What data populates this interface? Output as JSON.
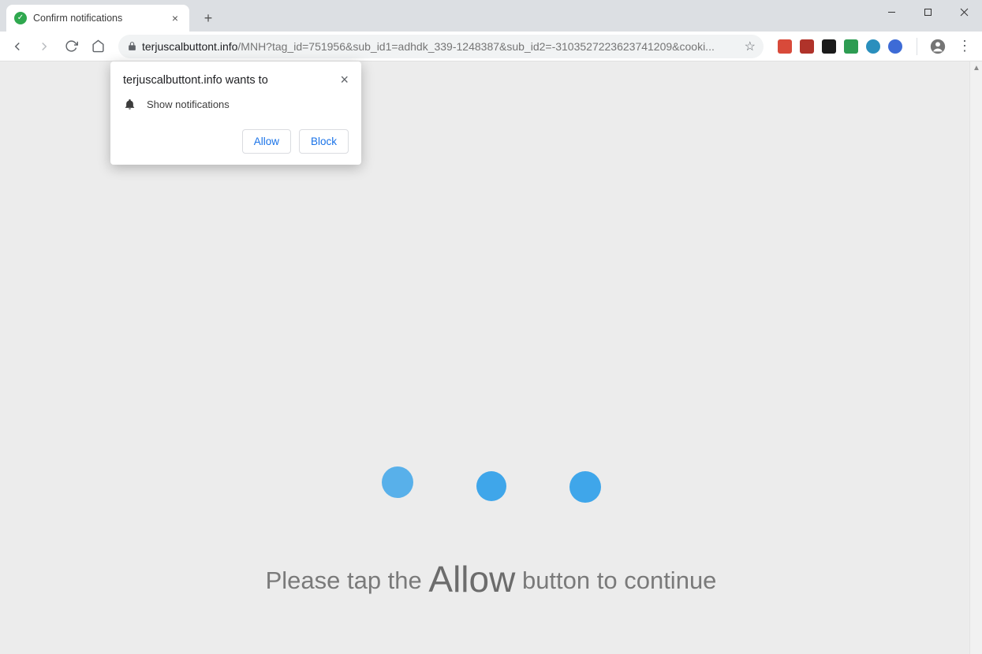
{
  "tab": {
    "title": "Confirm notifications"
  },
  "url": {
    "host": "terjuscalbuttont.info",
    "path": "/MNH?tag_id=751956&sub_id1=adhdk_339-1248387&sub_id2=-3103527223623741209&cooki..."
  },
  "permission": {
    "title": "terjuscalbuttont.info wants to",
    "row": "Show notifications",
    "allow": "Allow",
    "block": "Block"
  },
  "page": {
    "prompt_before": "Please tap the ",
    "prompt_allow": "Allow",
    "prompt_after": " button to continue"
  },
  "ext_colors": [
    "#d84a3a",
    "#b0332a",
    "#1b1b1b",
    "#2d9c52",
    "#2a8fbd",
    "#3d6bd6"
  ]
}
